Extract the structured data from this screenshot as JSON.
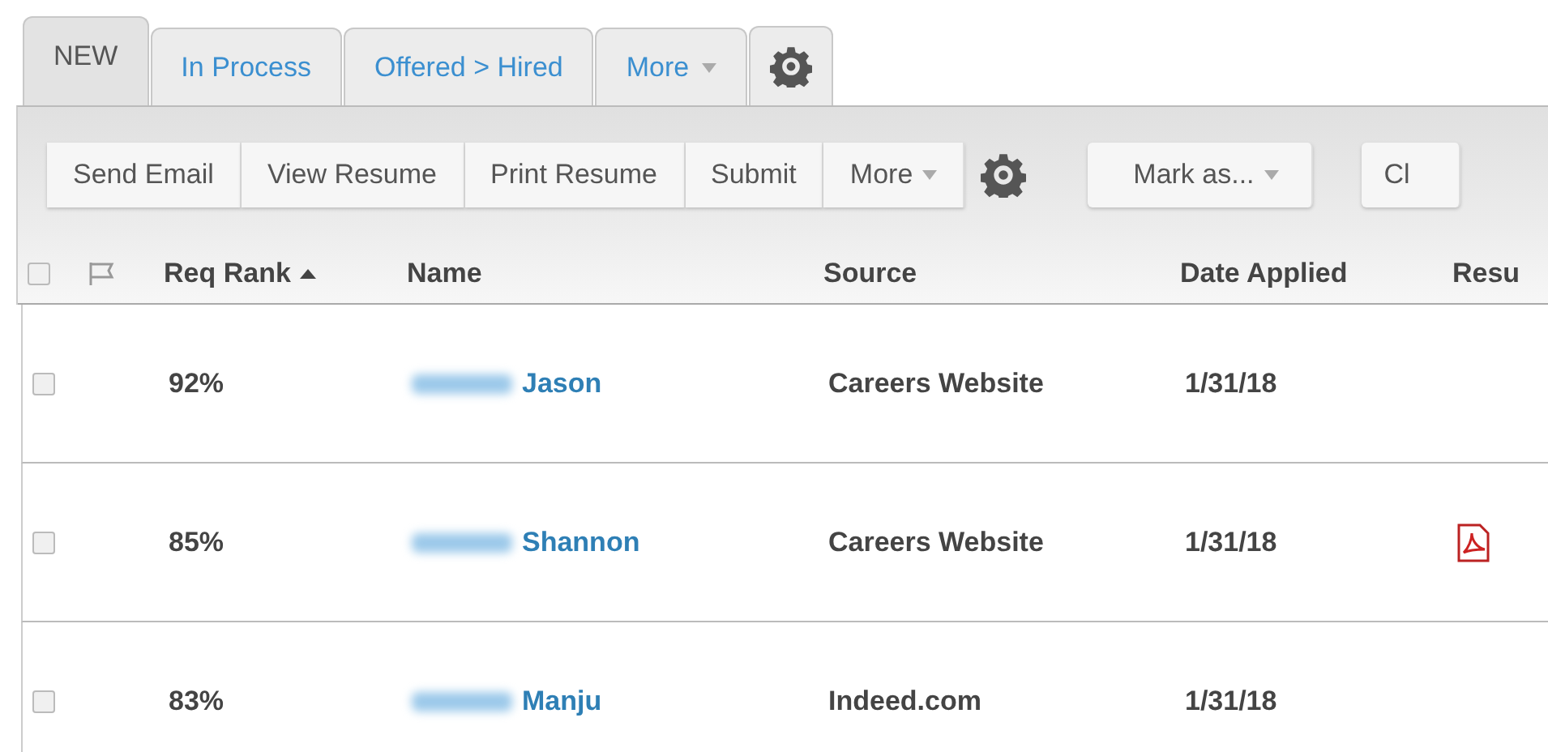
{
  "tabs": [
    {
      "label": "NEW",
      "selected": true,
      "dropdown": false
    },
    {
      "label": "In Process",
      "selected": false,
      "dropdown": false
    },
    {
      "label": "Offered > Hired",
      "selected": false,
      "dropdown": false
    },
    {
      "label": "More",
      "selected": false,
      "dropdown": true
    }
  ],
  "toolbar": {
    "group": [
      {
        "label": "Send Email",
        "dropdown": false
      },
      {
        "label": "View Resume",
        "dropdown": false
      },
      {
        "label": "Print Resume",
        "dropdown": false
      },
      {
        "label": "Submit",
        "dropdown": false
      },
      {
        "label": "More",
        "dropdown": true
      }
    ],
    "mark_as": {
      "label": "Mark as...",
      "dropdown": true
    },
    "cut_button": {
      "label": "Cl"
    }
  },
  "table": {
    "select_all": {
      "checked": false
    },
    "columns": [
      {
        "label": "Req Rank",
        "sorted": true
      },
      {
        "label": "Name",
        "sorted": false
      },
      {
        "label": "Source",
        "sorted": false
      },
      {
        "label": "Date Applied",
        "sorted": false
      },
      {
        "label": "Resu",
        "sorted": false
      }
    ],
    "rows": [
      {
        "checked": false,
        "rank": "92%",
        "name": "Jason",
        "source": "Careers Website",
        "date": "1/31/18",
        "resume": false
      },
      {
        "checked": false,
        "rank": "85%",
        "name": "Shannon",
        "source": "Careers Website",
        "date": "1/31/18",
        "resume": true
      },
      {
        "checked": false,
        "rank": "83%",
        "name": "Manju",
        "source": "Indeed.com",
        "date": "1/31/18",
        "resume": false
      }
    ]
  }
}
